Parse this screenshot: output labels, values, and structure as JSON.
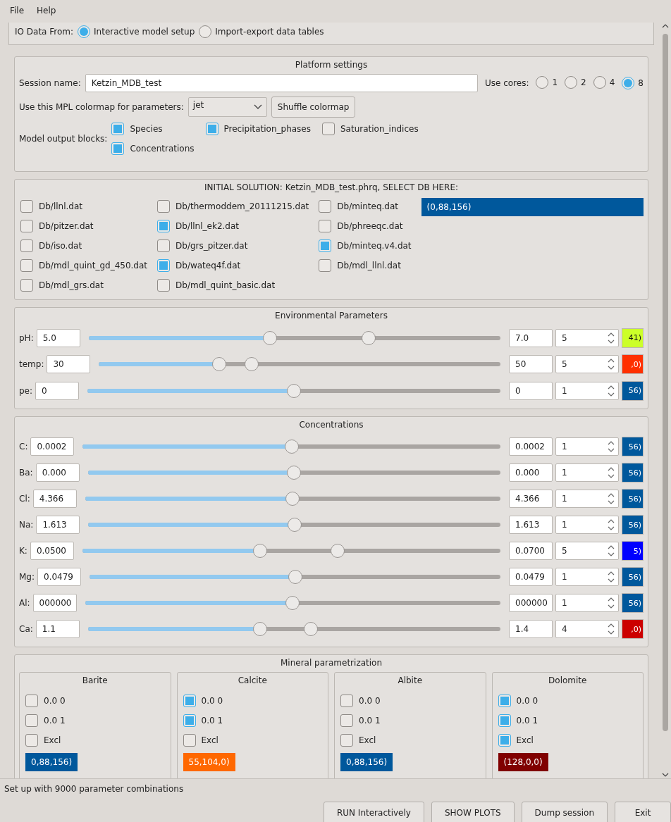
{
  "menu": [
    {
      "label": "File"
    },
    {
      "label": "Help"
    }
  ],
  "io_source": {
    "label": "IO Data From:",
    "options": [
      {
        "label": "Interactive model setup",
        "selected": true
      },
      {
        "label": "Import-export data tables",
        "selected": false
      }
    ]
  },
  "platform_settings": {
    "title": "Platform settings",
    "session_label": "Session name:",
    "session_value": "Ketzin_MDB_test",
    "cores_label": "Use cores:",
    "cores": [
      {
        "label": "1",
        "selected": false
      },
      {
        "label": "2",
        "selected": false
      },
      {
        "label": "4",
        "selected": false
      },
      {
        "label": "8",
        "selected": true
      }
    ],
    "colormap_label": "Use this MPL colormap for parameters:",
    "colormap_value": "jet",
    "shuffle_button": "Shuffle colormap",
    "output_label": "Model output blocks:",
    "output_blocks": [
      {
        "label": "Species",
        "checked": true
      },
      {
        "label": "Precipitation_phases",
        "checked": true
      },
      {
        "label": "Saturation_indices",
        "checked": false
      },
      {
        "label": "Concentrations",
        "checked": true
      }
    ]
  },
  "initial_solution": {
    "title": "INITIAL SOLUTION: Ketzin_MDB_test.phrq, SELECT DB HERE:",
    "columns": [
      [
        {
          "label": "Db/llnl.dat",
          "checked": false
        },
        {
          "label": "Db/pitzer.dat",
          "checked": false
        },
        {
          "label": "Db/iso.dat",
          "checked": false
        },
        {
          "label": "Db/mdl_quint_gd_450.dat",
          "checked": false
        },
        {
          "label": "Db/mdl_grs.dat",
          "checked": false
        }
      ],
      [
        {
          "label": "Db/thermoddem_20111215.dat",
          "checked": false
        },
        {
          "label": "Db/llnl_ek2.dat",
          "checked": true
        },
        {
          "label": "Db/grs_pitzer.dat",
          "checked": false
        },
        {
          "label": "Db/wateq4f.dat",
          "checked": true
        },
        {
          "label": "Db/mdl_quint_basic.dat",
          "checked": false
        }
      ],
      [
        {
          "label": "Db/minteq.dat",
          "checked": false
        },
        {
          "label": "Db/phreeqc.dat",
          "checked": false
        },
        {
          "label": "Db/minteq.v4.dat",
          "checked": true
        },
        {
          "label": "Db/mdl_llnl.dat",
          "checked": false
        }
      ]
    ],
    "swatch": {
      "label": "(0,88,156)",
      "color": "#00589c"
    }
  },
  "environmental_parameters": {
    "title": "Environmental Parameters",
    "rows": [
      {
        "label": "pH:",
        "min": "5.0",
        "handles": [
          {
            "level": 0.44
          },
          {
            "level": 0.68
          }
        ],
        "max": "7.0",
        "steps": "5",
        "swatch": {
          "label": "41)",
          "color": "#ccff29"
        }
      },
      {
        "label": "temp:",
        "min": "30",
        "handles": [
          {
            "level": 0.3
          },
          {
            "level": 0.38
          }
        ],
        "max": "50",
        "steps": "5",
        "swatch": {
          "label": ",0)",
          "color": "#ff3000"
        }
      },
      {
        "label": "pe:",
        "min": "0",
        "handles": [
          {
            "level": 0.5
          }
        ],
        "max": "0",
        "steps": "1",
        "swatch": {
          "label": "56)",
          "color": "#00589c"
        }
      }
    ]
  },
  "concentrations": {
    "title": "Concentrations",
    "rows": [
      {
        "label": "C:",
        "min": "0.0002",
        "handles": [
          {
            "level": 0.5
          }
        ],
        "max": "0.0002",
        "steps": "1",
        "swatch": {
          "label": "56)",
          "color": "#00589c"
        }
      },
      {
        "label": "Ba:",
        "min": "0.000",
        "handles": [
          {
            "level": 0.5
          }
        ],
        "max": "0.000",
        "steps": "1",
        "swatch": {
          "label": "56)",
          "color": "#00589c"
        }
      },
      {
        "label": "Cl:",
        "min": "4.366",
        "handles": [
          {
            "level": 0.5
          }
        ],
        "max": "4.366",
        "steps": "1",
        "swatch": {
          "label": "56)",
          "color": "#00589c"
        }
      },
      {
        "label": "Na:",
        "min": "1.613",
        "handles": [
          {
            "level": 0.5
          }
        ],
        "max": "1.613",
        "steps": "1",
        "swatch": {
          "label": "56)",
          "color": "#00589c"
        }
      },
      {
        "label": "K:",
        "min": "0.0500",
        "handles": [
          {
            "level": 0.425
          },
          {
            "level": 0.61
          }
        ],
        "max": "0.0700",
        "steps": "5",
        "swatch": {
          "label": "5)",
          "color": "#0000ff"
        }
      },
      {
        "label": "Mg:",
        "min": "0.0479",
        "handles": [
          {
            "level": 0.5
          }
        ],
        "max": "0.0479",
        "steps": "1",
        "swatch": {
          "label": "56)",
          "color": "#00589c"
        }
      },
      {
        "label": "Al:",
        "min": "000000",
        "handles": [
          {
            "level": 0.5
          }
        ],
        "max": "000000",
        "steps": "1",
        "swatch": {
          "label": "56)",
          "color": "#00589c"
        }
      },
      {
        "label": "Ca:",
        "min": "1.1",
        "handles": [
          {
            "level": 0.417
          },
          {
            "level": 0.54
          }
        ],
        "max": "1.4",
        "steps": "4",
        "swatch": {
          "label": ",0)",
          "color": "#cc0000"
        }
      }
    ]
  },
  "mineral_parametrization": {
    "title": "Mineral parametrization",
    "minerals": [
      {
        "name": "Barite",
        "options": [
          {
            "label": "0.0 0",
            "checked": false
          },
          {
            "label": "0.0 1",
            "checked": false
          },
          {
            "label": "Excl",
            "checked": false
          }
        ],
        "swatch": {
          "label": "0,88,156)",
          "color": "#00589c"
        }
      },
      {
        "name": "Calcite",
        "options": [
          {
            "label": "0.0 0",
            "checked": true
          },
          {
            "label": "0.0 1",
            "checked": true
          },
          {
            "label": "Excl",
            "checked": false
          }
        ],
        "swatch": {
          "label": "55,104,0)",
          "color": "#ff6800"
        }
      },
      {
        "name": "Albite",
        "options": [
          {
            "label": "0.0 0",
            "checked": false
          },
          {
            "label": "0.0 1",
            "checked": false
          },
          {
            "label": "Excl",
            "checked": false
          }
        ],
        "swatch": {
          "label": "0,88,156)",
          "color": "#00589c"
        }
      },
      {
        "name": "Dolomite",
        "options": [
          {
            "label": "0.0 0",
            "checked": true
          },
          {
            "label": "0.0 1",
            "checked": true
          },
          {
            "label": "Excl",
            "checked": true
          }
        ],
        "swatch": {
          "label": "(128,0,0)",
          "color": "#800000"
        }
      }
    ]
  },
  "status_bar": "Set up with 9000 parameter combinations",
  "buttons": [
    {
      "label": "RUN Interactively"
    },
    {
      "label": "SHOW PLOTS"
    },
    {
      "label": "Dump session"
    },
    {
      "label": "Exit"
    }
  ]
}
